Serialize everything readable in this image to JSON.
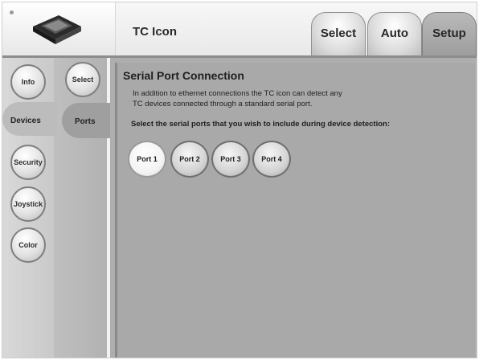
{
  "header": {
    "title": "TC Icon",
    "tabs": [
      {
        "label": "Select",
        "active": false
      },
      {
        "label": "Auto",
        "active": false
      },
      {
        "label": "Setup",
        "active": true
      }
    ]
  },
  "nav_primary": [
    {
      "label": "Info"
    },
    {
      "label": "Devices",
      "active": true
    },
    {
      "label": "Security"
    },
    {
      "label": "Joystick"
    },
    {
      "label": "Color"
    }
  ],
  "nav_secondary": [
    {
      "label": "Select"
    },
    {
      "label": "Ports",
      "active": true
    }
  ],
  "main": {
    "section_title": "Serial Port Connection",
    "description_line1": "In addition to ethernet connections the TC icon can detect any",
    "description_line2": "TC devices connected through a standard serial port.",
    "prompt": "Select the serial ports that you wish to include during device detection:",
    "ports": [
      {
        "label": "Port 1",
        "selected": true
      },
      {
        "label": "Port 2",
        "selected": false
      },
      {
        "label": "Port 3",
        "selected": false
      },
      {
        "label": "Port 4",
        "selected": false
      }
    ]
  },
  "icons": {
    "logo": "device-icon"
  }
}
